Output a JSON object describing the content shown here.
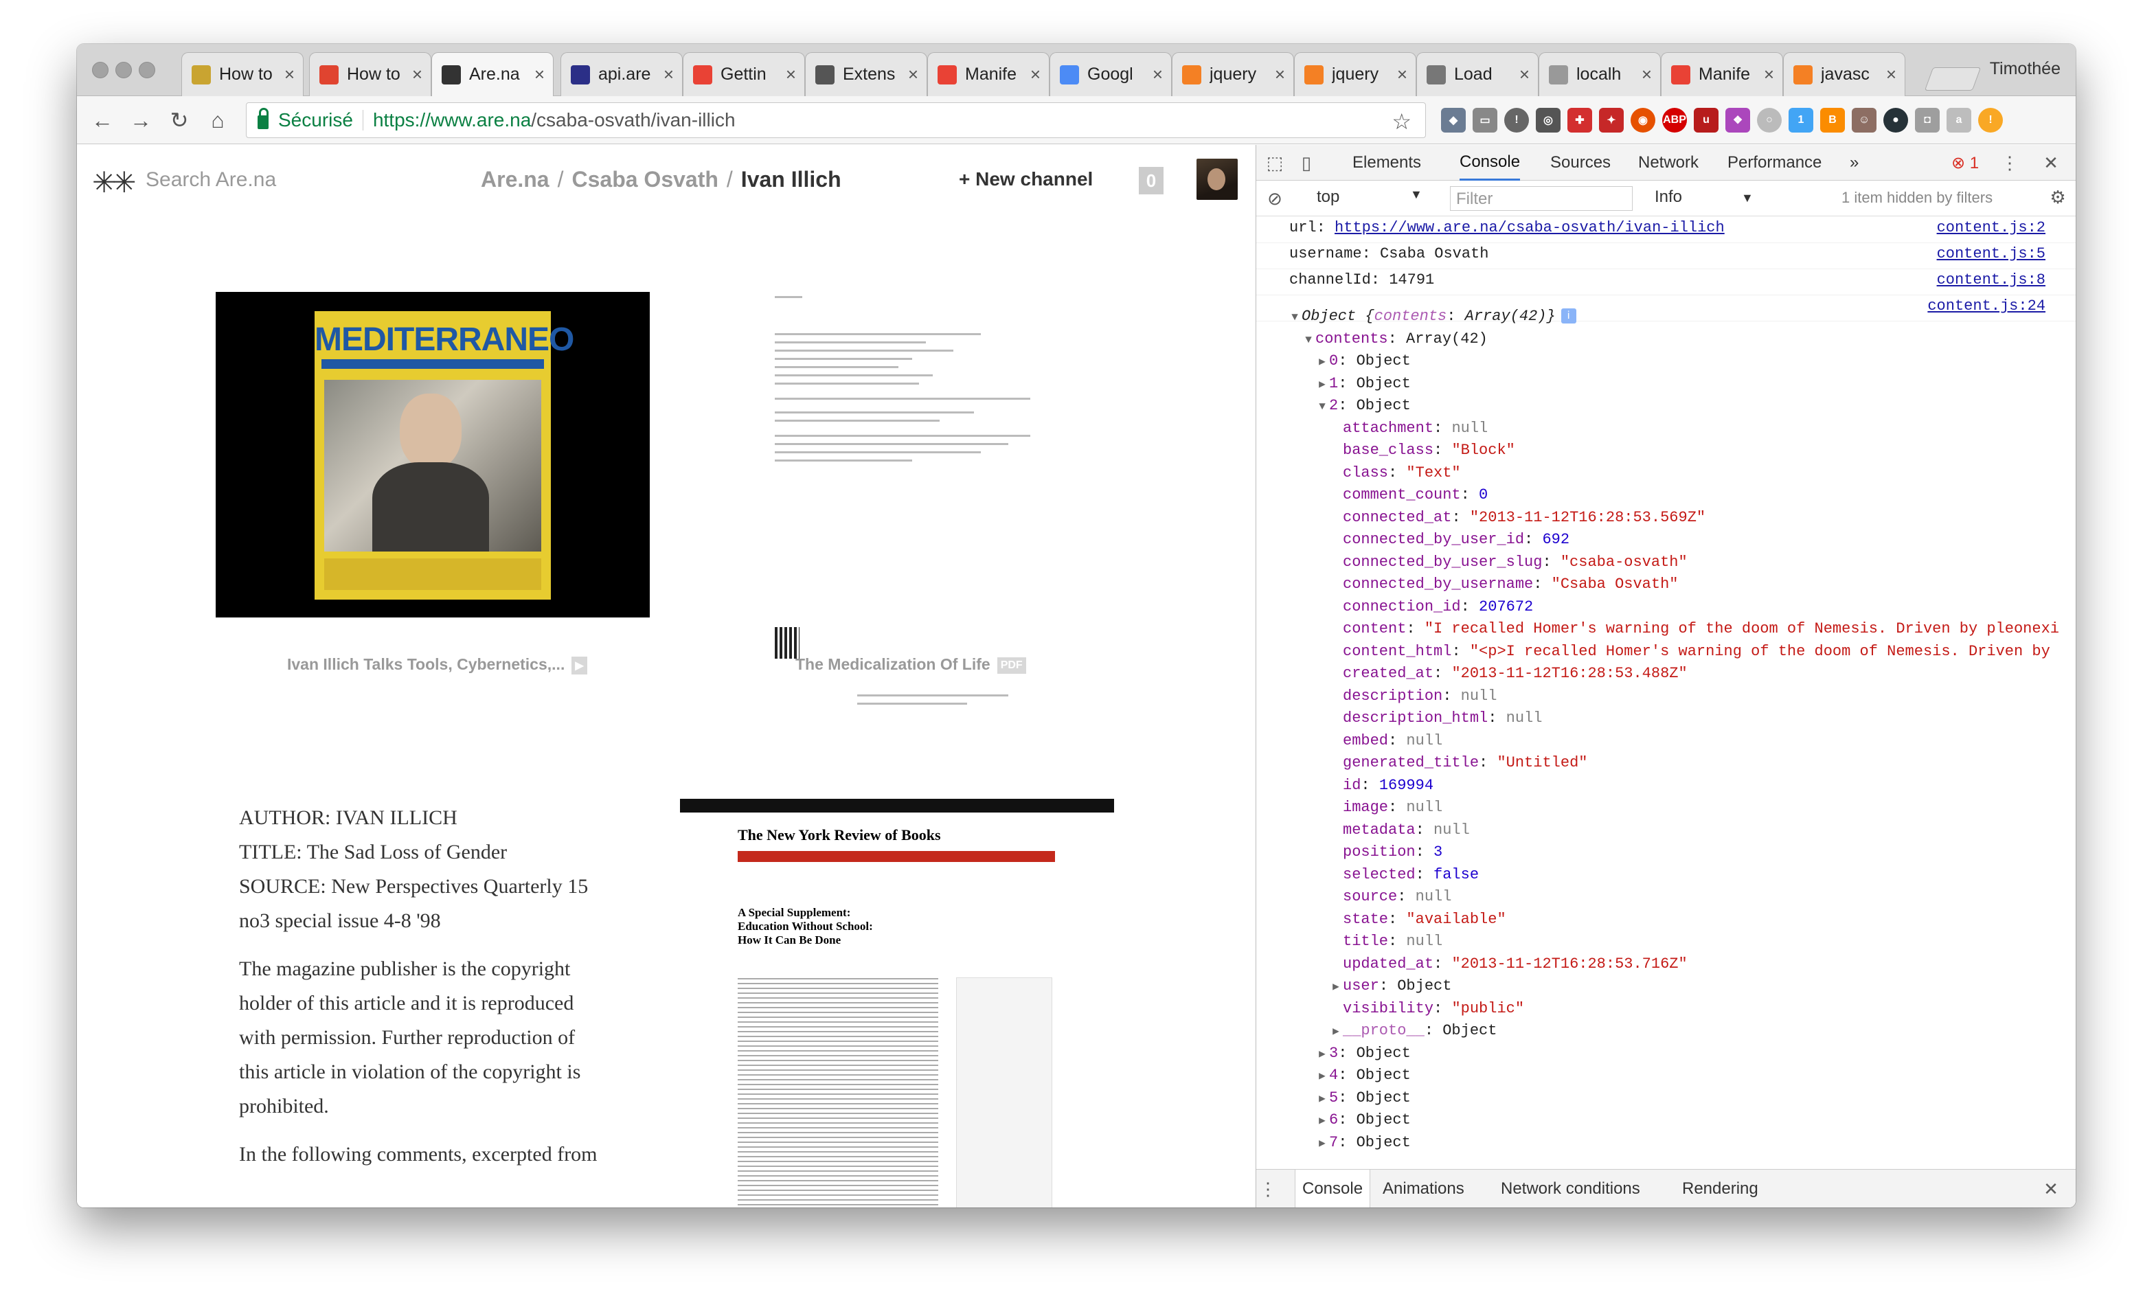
{
  "browser": {
    "profile_name": "Timothée",
    "tabs": [
      {
        "title": "How to",
        "icon": "stackexchange-icon",
        "color": "#c9a431"
      },
      {
        "title": "How to",
        "icon": "askubuntu-icon",
        "color": "#e04430"
      },
      {
        "title": "Are.na",
        "icon": "arena-icon",
        "color": "#333333",
        "active": true
      },
      {
        "title": "api.are",
        "icon": "arena-api-icon",
        "color": "#2b2f87"
      },
      {
        "title": "Gettin",
        "icon": "chrome-icon",
        "color": "#e94235"
      },
      {
        "title": "Extens",
        "icon": "puzzle-icon",
        "color": "#555555"
      },
      {
        "title": "Manife",
        "icon": "chrome-icon",
        "color": "#e94235"
      },
      {
        "title": "Googl",
        "icon": "google-docs-icon",
        "color": "#4c8bf5"
      },
      {
        "title": "jquery",
        "icon": "stackoverflow-icon",
        "color": "#f48024"
      },
      {
        "title": "jquery",
        "icon": "jquery-icon",
        "color": "#f48024"
      },
      {
        "title": "Load",
        "icon": "cube-icon",
        "color": "#777777"
      },
      {
        "title": "localh",
        "icon": "page-icon",
        "color": "#999999"
      },
      {
        "title": "Manife",
        "icon": "chrome-icon",
        "color": "#e94235"
      },
      {
        "title": "javasc",
        "icon": "stackoverflow-icon",
        "color": "#f48024"
      }
    ],
    "secure_label": "Sécurisé",
    "url_scheme": "https://",
    "url_host": "www.are.na",
    "url_path": "/csaba-osvath/ivan-illich"
  },
  "page": {
    "search_placeholder": "Search Are.na",
    "breadcrumb": {
      "root": "Are.na",
      "user": "Csaba Osvath",
      "channel": "Ivan Illich",
      "separator": "/"
    },
    "new_channel_label": "New channel",
    "count": "0",
    "blocks": [
      {
        "caption": "Ivan Illich Talks Tools, Cybernetics,...",
        "badge": "▶"
      },
      {
        "caption": "The Medicalization Of Life",
        "badge": "PDF"
      }
    ],
    "magazine_title": "MEDITERRANEO",
    "nyr_title": "The New York Review of Books",
    "nyr_headline": "A Special Supplement: Education Without School: How It Can Be Done",
    "text_block": {
      "p1": [
        "AUTHOR: IVAN ILLICH",
        "TITLE: The Sad Loss of Gender",
        "SOURCE: New Perspectives Quarterly 15",
        "no3 special issue 4-8 '98"
      ],
      "p2": [
        "The magazine publisher is the copyright",
        "holder of this article and it is reproduced",
        "with permission. Further reproduction of",
        "this article in violation of the copyright is",
        "prohibited."
      ],
      "p3": [
        "In the following comments, excerpted from"
      ]
    }
  },
  "devtools": {
    "tabs": [
      "Elements",
      "Console",
      "Sources",
      "Network",
      "Performance",
      "»"
    ],
    "active_tab": "Console",
    "error_count": "1",
    "context": "top",
    "filter_placeholder": "Filter",
    "level": "Info",
    "hidden_msg": "1 item hidden by filters",
    "logs": [
      {
        "label": "url:",
        "value": "https://www.are.na/csaba-osvath/ivan-illich",
        "source": "content.js:2",
        "link": true
      },
      {
        "label": "username:",
        "value": "Csaba Osvath",
        "source": "content.js:5"
      },
      {
        "label": "channelId:",
        "value": "14791",
        "source": "content.js:8"
      },
      {
        "label": "",
        "value": "",
        "source": "content.js:24"
      }
    ],
    "object_summary": {
      "prefix": "Object ",
      "brace_open": "{",
      "key": "contents",
      "value": "Array(42)",
      "brace_close": "}"
    },
    "contents_line": {
      "key": "contents",
      "value": "Array(42)"
    },
    "collapsed_top": [
      {
        "key": "0",
        "value": "Object"
      },
      {
        "key": "1",
        "value": "Object"
      }
    ],
    "expanded_item": {
      "key": "2",
      "value": "Object"
    },
    "props": [
      {
        "key": "attachment",
        "value": "null",
        "type": "null"
      },
      {
        "key": "base_class",
        "value": "\"Block\"",
        "type": "string"
      },
      {
        "key": "class",
        "value": "\"Text\"",
        "type": "string"
      },
      {
        "key": "comment_count",
        "value": "0",
        "type": "number"
      },
      {
        "key": "connected_at",
        "value": "\"2013-11-12T16:28:53.569Z\"",
        "type": "string"
      },
      {
        "key": "connected_by_user_id",
        "value": "692",
        "type": "number"
      },
      {
        "key": "connected_by_user_slug",
        "value": "\"csaba-osvath\"",
        "type": "string"
      },
      {
        "key": "connected_by_username",
        "value": "\"Csaba Osvath\"",
        "type": "string"
      },
      {
        "key": "connection_id",
        "value": "207672",
        "type": "number"
      },
      {
        "key": "content",
        "value": "\"I recalled Homer's warning of the doom of Nemesis. Driven by pleonexi",
        "type": "string"
      },
      {
        "key": "content_html",
        "value": "\"<p>I recalled Homer's warning of the doom of Nemesis. Driven by",
        "type": "string"
      },
      {
        "key": "created_at",
        "value": "\"2013-11-12T16:28:53.488Z\"",
        "type": "string"
      },
      {
        "key": "description",
        "value": "null",
        "type": "null"
      },
      {
        "key": "description_html",
        "value": "null",
        "type": "null"
      },
      {
        "key": "embed",
        "value": "null",
        "type": "null"
      },
      {
        "key": "generated_title",
        "value": "\"Untitled\"",
        "type": "string"
      },
      {
        "key": "id",
        "value": "169994",
        "type": "number"
      },
      {
        "key": "image",
        "value": "null",
        "type": "null"
      },
      {
        "key": "metadata",
        "value": "null",
        "type": "null"
      },
      {
        "key": "position",
        "value": "3",
        "type": "number"
      },
      {
        "key": "selected",
        "value": "false",
        "type": "number"
      },
      {
        "key": "source",
        "value": "null",
        "type": "null"
      },
      {
        "key": "state",
        "value": "\"available\"",
        "type": "string"
      },
      {
        "key": "title",
        "value": "null",
        "type": "null"
      },
      {
        "key": "updated_at",
        "value": "\"2013-11-12T16:28:53.716Z\"",
        "type": "string"
      }
    ],
    "sub_objects": [
      {
        "key": "user",
        "value": "Object",
        "arrow": true
      },
      {
        "key": "visibility",
        "value": "\"public\"",
        "type": "string",
        "arrow": false
      },
      {
        "key": "__proto__",
        "value": "Object",
        "arrow": true
      }
    ],
    "collapsed_bottom": [
      {
        "key": "3",
        "value": "Object"
      },
      {
        "key": "4",
        "value": "Object"
      },
      {
        "key": "5",
        "value": "Object"
      },
      {
        "key": "6",
        "value": "Object"
      },
      {
        "key": "7",
        "value": "Object"
      }
    ],
    "drawer_tabs": [
      "Console",
      "Animations",
      "Network conditions",
      "Rendering"
    ]
  }
}
